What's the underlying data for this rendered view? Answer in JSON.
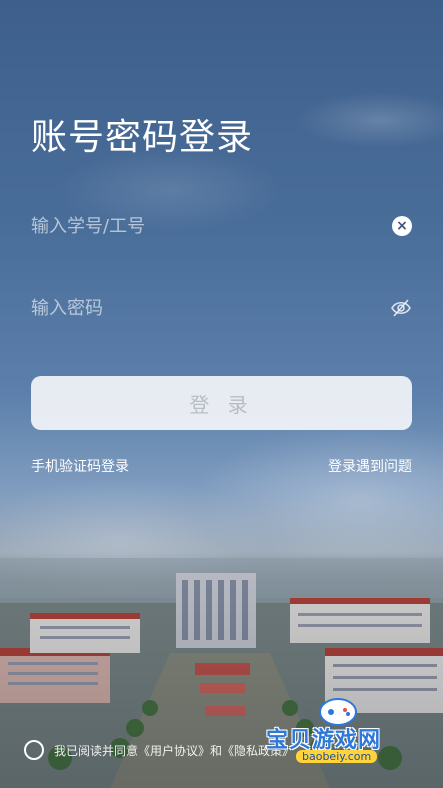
{
  "title": "账号密码登录",
  "id_field": {
    "placeholder": "输入学号/工号",
    "value": ""
  },
  "password_field": {
    "placeholder": "输入密码",
    "value": ""
  },
  "login_button": "登 录",
  "sms_login_link": "手机验证码登录",
  "help_link": "登录遇到问题",
  "agreement": {
    "prefix": "我已阅读并同意",
    "user_agreement": "《用户协议》",
    "and": "和",
    "privacy_policy": "《隐私政策》"
  },
  "watermark": {
    "text": "宝贝游戏网",
    "url": "baobeiy.com"
  },
  "colors": {
    "accent": "#3e5f8c",
    "button_bg": "#f2f4f8",
    "button_text": "#b8bcc4"
  }
}
